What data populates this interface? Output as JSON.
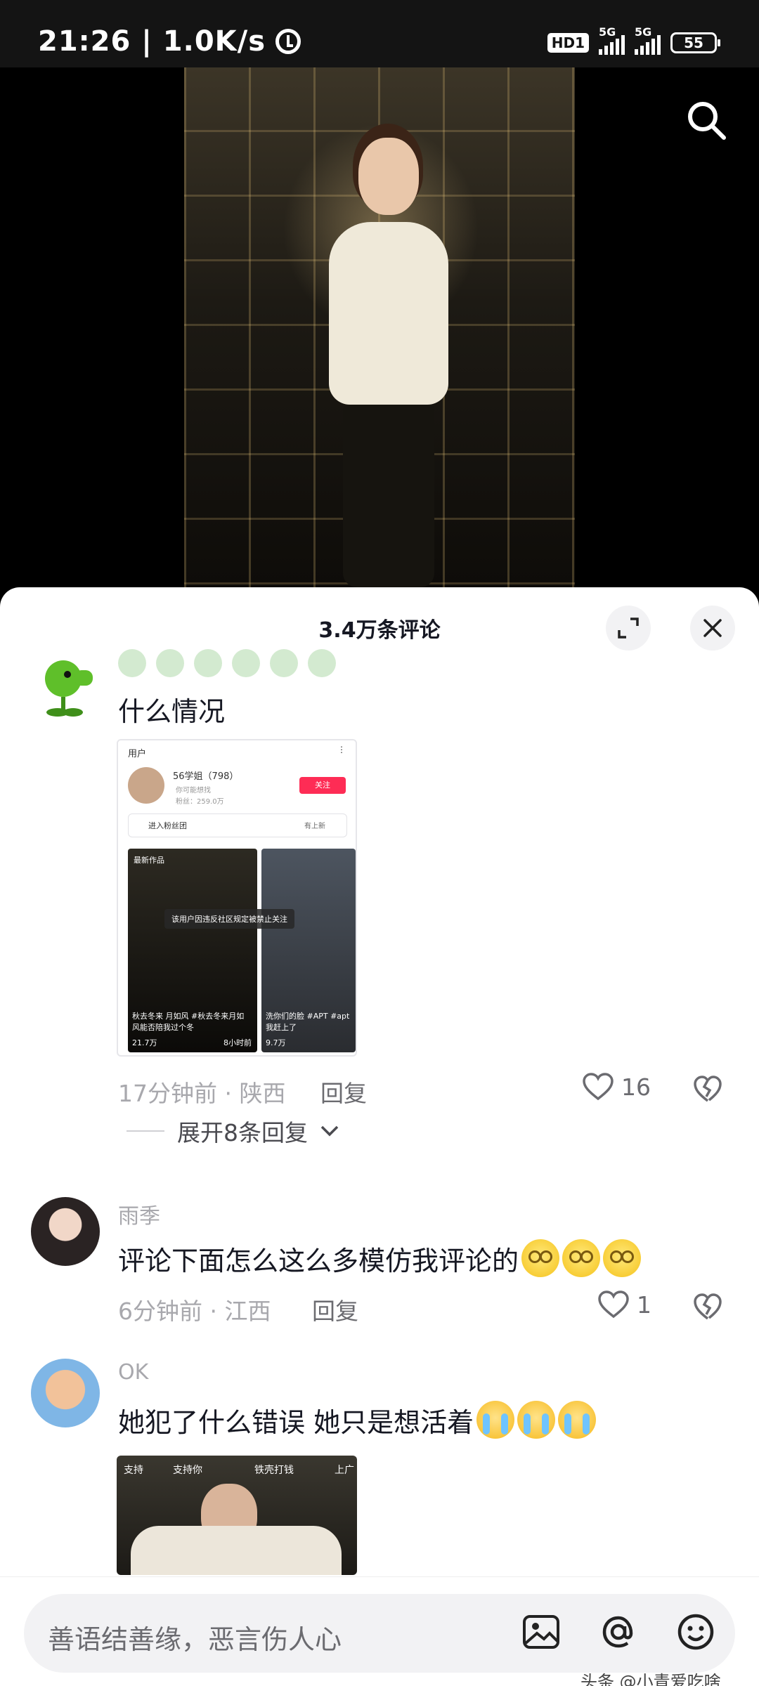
{
  "status_bar": {
    "time": "21:26",
    "speed": "1.0K/s",
    "hd_badge": "HD1",
    "net1": "5G",
    "net2": "5G",
    "battery": "55"
  },
  "sheet": {
    "title": "3.4万条评论"
  },
  "comments": [
    {
      "text": "什么情况",
      "time": "17分钟前",
      "location": "陕西",
      "reply_label": "回复",
      "likes": "16",
      "screenshot": {
        "header": "用户",
        "name": "56学姐（798）",
        "sub": "你可能想找",
        "fans": "粉丝：259.0万",
        "follow": "关注",
        "fans_group": "进入粉丝团",
        "fans_group_tag": "有上新",
        "works_tag": "最新作品",
        "ban_notice": "该用户因违反社区规定被禁止关注",
        "caption1": "秋去冬来 月如风 #秋去冬来月如",
        "caption1b": "风能否陪我过个冬",
        "likes1": "21.7万",
        "ago1": "8小时前",
        "caption2": "洗你们的脸 #APT #apt",
        "caption2b": "我赶上了",
        "likes2": "9.7万"
      },
      "expand_replies": "展开8条回复"
    },
    {
      "user": "雨季",
      "text": "评论下面怎么这么多模仿我评论的",
      "time": "6分钟前",
      "location": "江西",
      "reply_label": "回复",
      "likes": "1"
    },
    {
      "user": "OK",
      "text": "她犯了什么错误 她只是想活着",
      "video_tags": [
        "支持",
        "支持你",
        "铁壳打钱",
        "上广"
      ]
    }
  ],
  "input_bar": {
    "placeholder": "善语结善缘，恶言伤人心"
  },
  "watermark": "头条 @小青爱吃啥",
  "icons": [
    "search-icon",
    "expand-icon",
    "close-icon",
    "heart-icon",
    "dislike-icon",
    "chevron-down-icon",
    "image-icon",
    "at-icon",
    "emoji-icon",
    "alarm-icon"
  ],
  "colors": {
    "accent": "#fe2c55",
    "sheet_bg": "#ffffff",
    "muted_text": "#a8a8ad"
  }
}
